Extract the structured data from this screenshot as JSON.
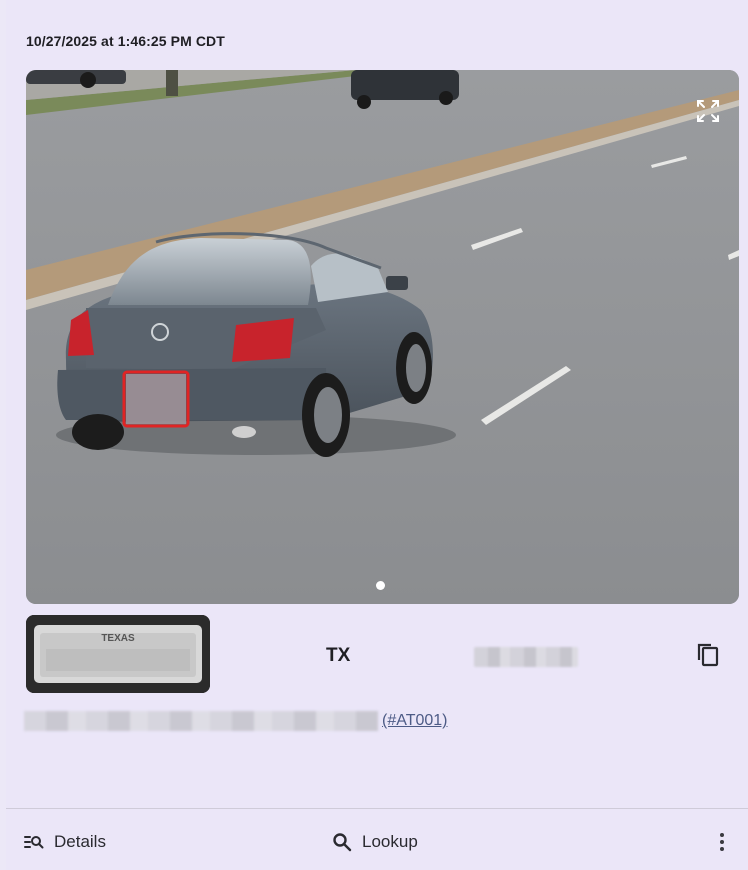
{
  "capture": {
    "timestamp": "10/27/2025 at 1:46:25 PM CDT"
  },
  "plate": {
    "state": "TX",
    "crop_label": "TEXAS"
  },
  "agency": {
    "code": "(#AT001)"
  },
  "footer": {
    "details_label": "Details",
    "lookup_label": "Lookup"
  },
  "icons": {
    "expand": "expand-icon",
    "copy": "copy-icon",
    "details": "details-search-icon",
    "lookup": "search-icon",
    "more": "kebab-menu-icon"
  },
  "colors": {
    "card_background": "#ebe6f8",
    "link": "#4d5b86",
    "plate_highlight": "#e02424"
  }
}
